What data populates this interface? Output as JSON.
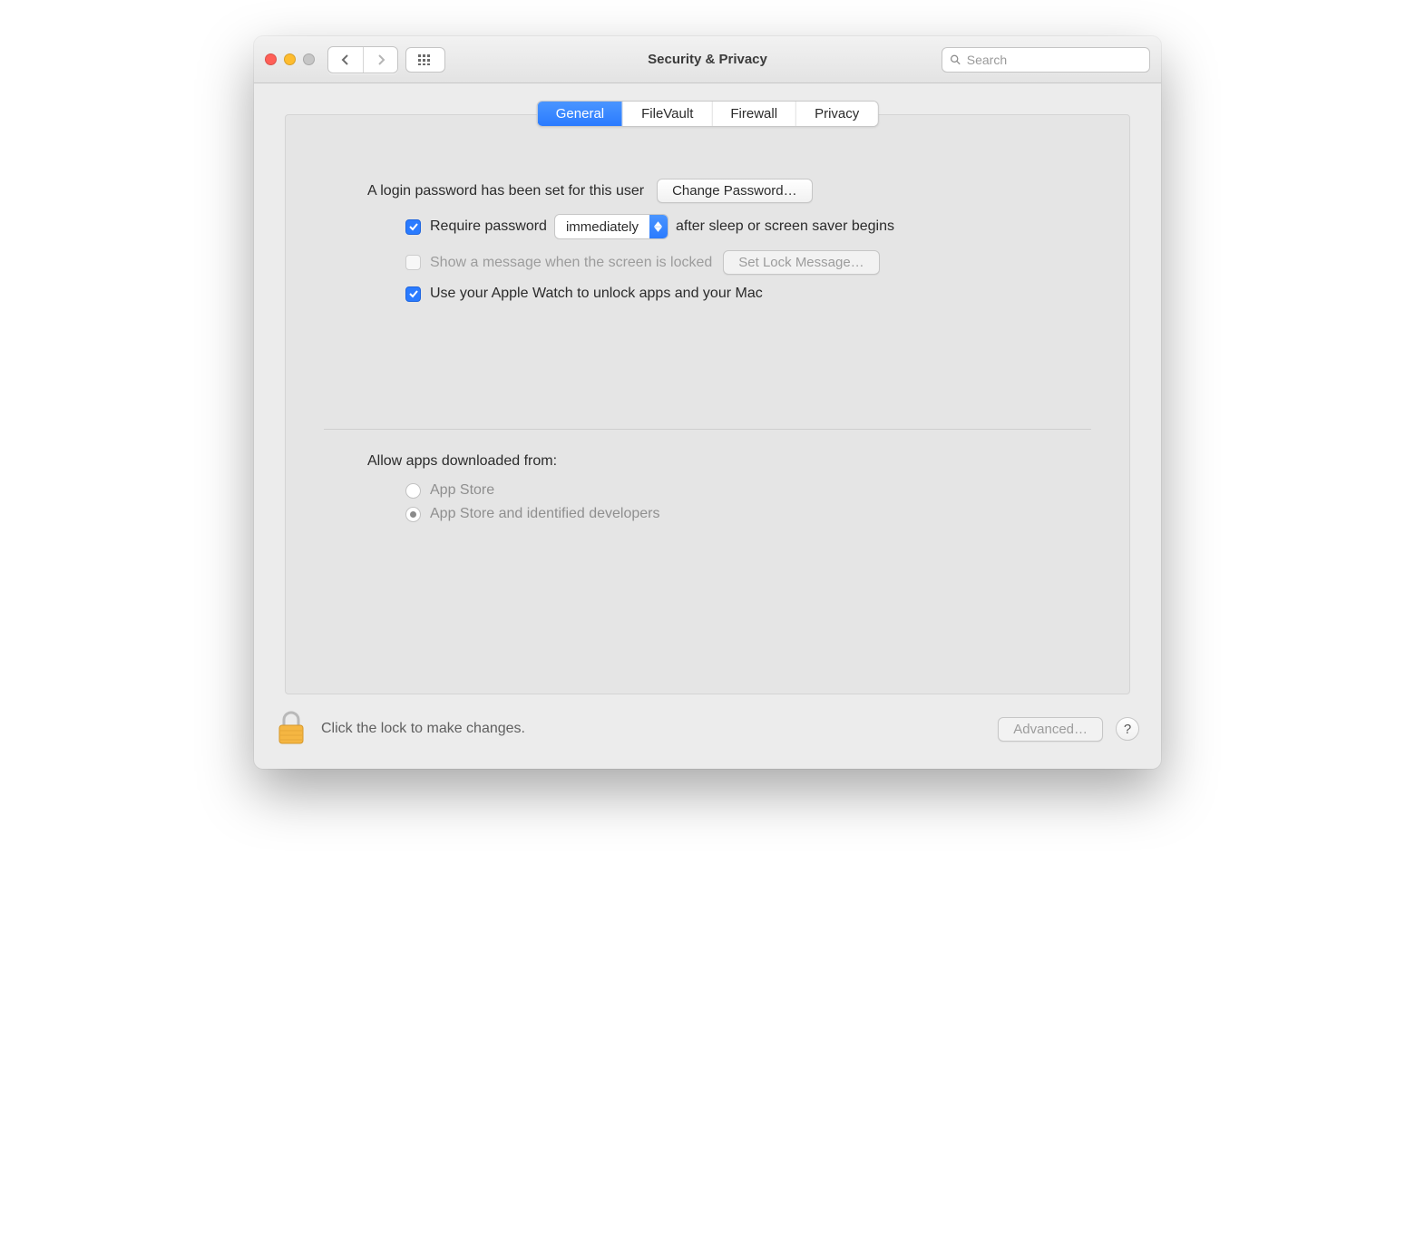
{
  "window": {
    "title": "Security & Privacy"
  },
  "toolbar": {
    "search_placeholder": "Search"
  },
  "tabs": {
    "items": [
      "General",
      "FileVault",
      "Firewall",
      "Privacy"
    ],
    "active_index": 0
  },
  "general": {
    "login_password_text": "A login password has been set for this user",
    "change_password_button": "Change Password…",
    "require_password": {
      "checked": true,
      "label_before": "Require password",
      "popup_value": "immediately",
      "label_after": "after sleep or screen saver begins"
    },
    "show_lock_message": {
      "checked": false,
      "disabled": true,
      "label": "Show a message when the screen is locked",
      "button": "Set Lock Message…"
    },
    "apple_watch": {
      "checked": true,
      "label": "Use your Apple Watch to unlock apps and your Mac"
    },
    "allow_apps": {
      "heading": "Allow apps downloaded from:",
      "options": [
        {
          "label": "App Store",
          "selected": false
        },
        {
          "label": "App Store and identified developers",
          "selected": true
        }
      ],
      "disabled": true
    }
  },
  "footer": {
    "lock_text": "Click the lock to make changes.",
    "advanced_button": "Advanced…",
    "help_label": "?"
  }
}
